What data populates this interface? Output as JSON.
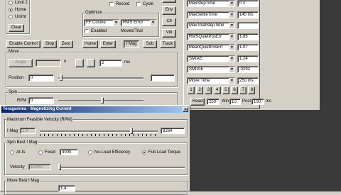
{
  "left_panel": {
    "radio_options": [
      "Limit 2",
      "Home",
      "Unlmt"
    ],
    "clear_label": "Clear"
  },
  "record_label": "Record",
  "cycle_label": "Cycle",
  "side_buttons": [
    "Env",
    "Ctl",
    "Vib"
  ],
  "optimize": {
    "title": "Optimize",
    "combo1": "FF Cosine",
    "combo2": "RMS Error",
    "enabled_label": "Enabled",
    "moves_trial_label": "Moves/Trial"
  },
  "toolbar": {
    "enable_control": "Enable Control",
    "stop": "Stop",
    "zero": "Zero",
    "home": "Home",
    "enter": "Enter",
    "imag": "I Mag",
    "sub": "Sub",
    "track": "Track"
  },
  "move": {
    "title": "Move",
    "angle_label": "Angle",
    "unit_deg": "o",
    "step_value": "2",
    "unit_ms": "ms",
    "position_label": "Position",
    "position_value": "0"
  },
  "spin": {
    "title": "Spin",
    "rpm_label": "RPM",
    "rpm_value": "0"
  },
  "metrics": [
    {
      "name": "MaxStepTime",
      "value": "0 s"
    },
    {
      "name": "MaxSettleTime",
      "value": "145 ms"
    },
    {
      "name": "MaxTotalStepTime",
      "value": ""
    },
    {
      "name": "RMSQuietPosErr",
      "value": "1.85"
    },
    {
      "name": "MeanQuietPosErr",
      "value": "1.07"
    },
    {
      "name": "SMIAE",
      "value": "1.24"
    },
    {
      "name": "SMIIAE",
      "value": ".0292"
    },
    {
      "name": "Move Time",
      "value": "250 ms"
    }
  ],
  "numbered_buttons": [
    "1",
    "2",
    "3",
    "4",
    "5",
    "6",
    "7",
    "8"
  ],
  "bottom_row": {
    "read_label": "Read",
    "read_value": "250",
    "win_label": "Win",
    "win_value": "10",
    "post_label": "Post",
    "post_value": "100",
    "unit": "ms"
  },
  "dialog": {
    "title": "Teragamma - Magnetizing Current",
    "close_icon": "close-icon",
    "max_vel_title": "Maximum Feasible Velocity (RPM)",
    "imag_label": "I Mag",
    "imag_value": "1.4",
    "rpm_value": "8264",
    "slider_fraction": 0.78,
    "spin_best_title": "Spin Best I Mag",
    "radio_atis": "At-Is",
    "radio_fixed": "Fixed",
    "fixed_value": "4000",
    "radio_noload": "No-Load Efficiency",
    "radio_fullload": "Full-Load Torque",
    "velocity_label": "Velocity",
    "velocity_value": "10000",
    "move_best_title": "Move Best I Mag",
    "move_best_value": "1.4"
  }
}
